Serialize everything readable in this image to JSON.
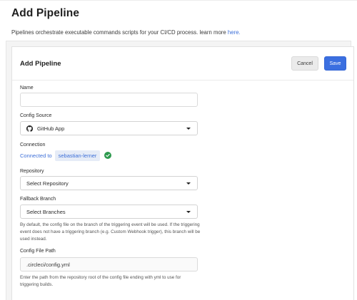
{
  "page": {
    "title": "Add Pipeline",
    "description": "Pipelines orchestrate executable commands scripts for your CI/CD process. learn more",
    "learn_more_link": "here."
  },
  "card": {
    "title": "Add Pipeline",
    "cancel_label": "Cancel",
    "save_label": "Save"
  },
  "form": {
    "name": {
      "label": "Name",
      "value": ""
    },
    "config_source": {
      "label": "Config Source",
      "value": "GitHub App",
      "icon": "github-icon"
    },
    "connection": {
      "label": "Connection",
      "prefix": "Connected to",
      "user": "sebastian-lerner",
      "status_icon": "check-circle-icon"
    },
    "repository": {
      "label": "Repository",
      "value": "Select Repository"
    },
    "fallback_branch": {
      "label": "Fallback Branch",
      "value": "Select Branches",
      "help": "By default, the config file on the branch of the triggering event will be used. If the triggering event does not have a triggering branch (e.g. Custom Webhook trigger), this branch will be used instead."
    },
    "config_file_path": {
      "label": "Config File Path",
      "value": ".circleci/config.yml",
      "help": "Enter the path from the repository root of the config file ending with yml to use for triggering builds."
    }
  },
  "colors": {
    "accent": "#3b6fe0",
    "link": "#3d6fd8",
    "success": "#2e9a4e"
  }
}
